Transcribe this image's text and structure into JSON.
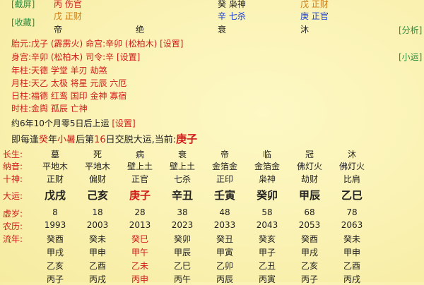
{
  "top": {
    "screenshot_link": "[截屏]",
    "favorite_link": "[收藏]",
    "analyze_link": "[分析]",
    "brief_link": "[小运]",
    "row1": [
      {
        "text": "丙 伤官",
        "color": "#d11a1a"
      },
      {
        "text": "癸 枭神",
        "color": "#222222"
      },
      {
        "text": "戊 正财",
        "color": "#d07a10"
      }
    ],
    "row2": [
      {
        "text": "戊 正财",
        "color": "#d07a10"
      },
      {
        "text": "辛 七杀",
        "color": "#1a3fd1"
      },
      {
        "text": "庚 正官",
        "color": "#1a3fd1"
      }
    ],
    "row3": [
      "帝",
      "绝",
      "衰",
      "沐"
    ]
  },
  "info": {
    "taiyuan": {
      "label": "胎元:",
      "value": "戊子 (霹雳火)"
    },
    "minggong": {
      "label": "命宫:",
      "value": "辛卯 (松柏木)"
    },
    "set1": "[设置]",
    "shengong": {
      "label": "身宫:",
      "value": "辛卯 (松柏木)"
    },
    "siling": {
      "label": "司令:",
      "value": "辛"
    },
    "set2": "[设置]",
    "year_pillar": {
      "label": "年柱:",
      "value": "天德 学堂 羊刃 劫煞"
    },
    "month_pillar": {
      "label": "月柱:",
      "value": "天乙 太极 将星 元辰 六厄"
    },
    "day_pillar": {
      "label": "日柱:",
      "value": "福德 红鸾 国印 金神 寡宿"
    },
    "hour_pillar": {
      "label": "时柱:",
      "value": "金舆 孤辰 亡神"
    },
    "start_luck": "约6年10个月零5日后上运",
    "set3": "[设置]",
    "change_prefix": "即每逢",
    "change_stem": "癸",
    "change_mid": "年",
    "change_term": "小暑",
    "change_after": "后第",
    "change_day": "16",
    "change_suffix": "日交脱大运,当前:",
    "current_luck": "庚子"
  },
  "table": {
    "labels": {
      "changsheng": "长生:",
      "nayin": "纳音:",
      "shishen": "十神:",
      "dayun": "大运:",
      "xusui": "虚岁:",
      "nongli": "农历:",
      "liunian": "流年:"
    },
    "changsheng": [
      "墓",
      "死",
      "病",
      "衰",
      "帝",
      "临",
      "冠",
      "沐"
    ],
    "nayin": [
      "平地木",
      "平地木",
      "壁上土",
      "壁上土",
      "金箔金",
      "金箔金",
      "佛灯火",
      "佛灯火"
    ],
    "shishen": [
      "正财",
      "偏财",
      "正官",
      "七杀",
      "正印",
      "枭神",
      "劫财",
      "比肩"
    ],
    "dayun": [
      "戊戌",
      "己亥",
      "庚子",
      "辛丑",
      "壬寅",
      "癸卯",
      "甲辰",
      "乙巳"
    ],
    "dayun_current_index": 2,
    "xusui": [
      "8",
      "18",
      "28",
      "38",
      "48",
      "58",
      "68",
      "78"
    ],
    "nongli": [
      "1993",
      "2003",
      "2013",
      "2023",
      "2033",
      "2043",
      "2053",
      "2063"
    ],
    "liunian_rows": [
      [
        "癸酉",
        "癸未",
        "癸巳",
        "癸卯",
        "癸丑",
        "癸亥",
        "癸酉",
        "癸未"
      ],
      [
        "甲戌",
        "甲申",
        "甲午",
        "甲辰",
        "甲寅",
        "甲子",
        "甲戌",
        "甲申"
      ],
      [
        "乙亥",
        "乙酉",
        "乙未",
        "乙巳",
        "乙卯",
        "乙丑",
        "乙亥",
        "乙酉"
      ],
      [
        "丙子",
        "丙戌",
        "丙申",
        "丙午",
        "丙辰",
        "丙寅",
        "丙子",
        "丙戌"
      ]
    ],
    "highlight_color": "#d11a1a"
  }
}
